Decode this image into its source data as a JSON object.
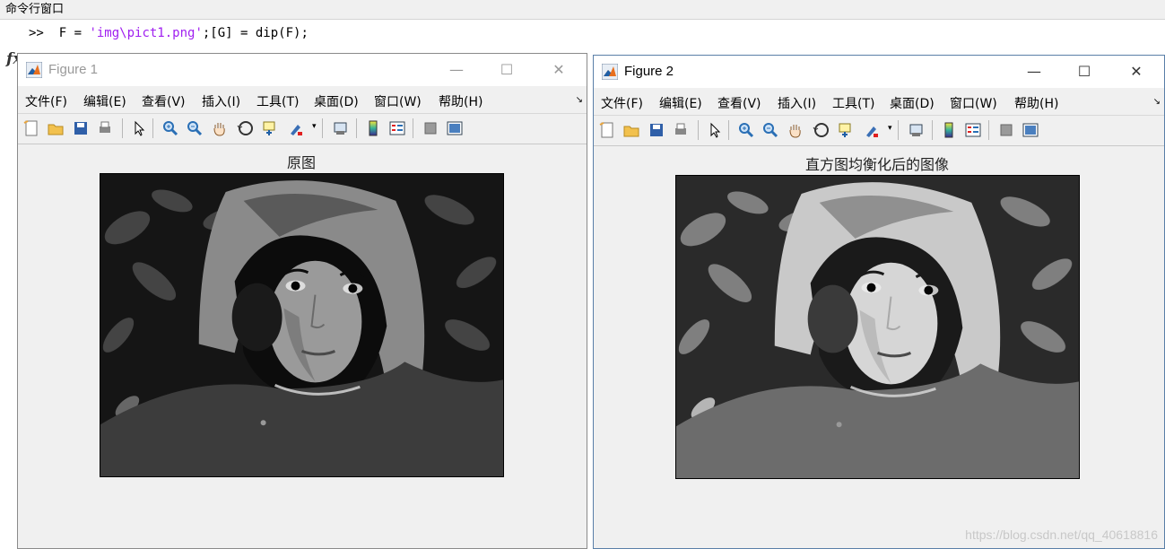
{
  "command_window": {
    "title": "命令行窗口",
    "prompt": ">>",
    "line_part1": "  F = ",
    "line_string": "'img\\pict1.png'",
    "line_part2": ";[G] = dip(F);",
    "fx_label": "fx"
  },
  "figures": [
    {
      "title": "Figure 1",
      "axes_title": "原图",
      "brightness": "original"
    },
    {
      "title": "Figure 2",
      "axes_title": "直方图均衡化后的图像",
      "brightness": "equalized"
    }
  ],
  "menu": [
    "文件(F)",
    "编辑(E)",
    "查看(V)",
    "插入(I)",
    "工具(T)",
    "桌面(D)",
    "窗口(W)",
    "帮助(H)"
  ],
  "window_buttons": {
    "minimize": "—",
    "maximize": "☐",
    "close": "✕"
  },
  "toolbar_icons": [
    "new-figure-icon",
    "open-file-icon",
    "save-icon",
    "print-icon",
    "pointer-icon",
    "zoom-in-icon",
    "zoom-out-icon",
    "pan-icon",
    "rotate-3d-icon",
    "data-cursor-icon",
    "brush-icon",
    "link-plot-icon",
    "colorbar-icon",
    "legend-icon",
    "hide-plot-tools-icon",
    "show-plot-tools-icon"
  ],
  "watermark": "https://blog.csdn.net/qq_40618816",
  "colors": {
    "accent_border": "#5a7fa8",
    "string_literal": "#a020f0"
  }
}
